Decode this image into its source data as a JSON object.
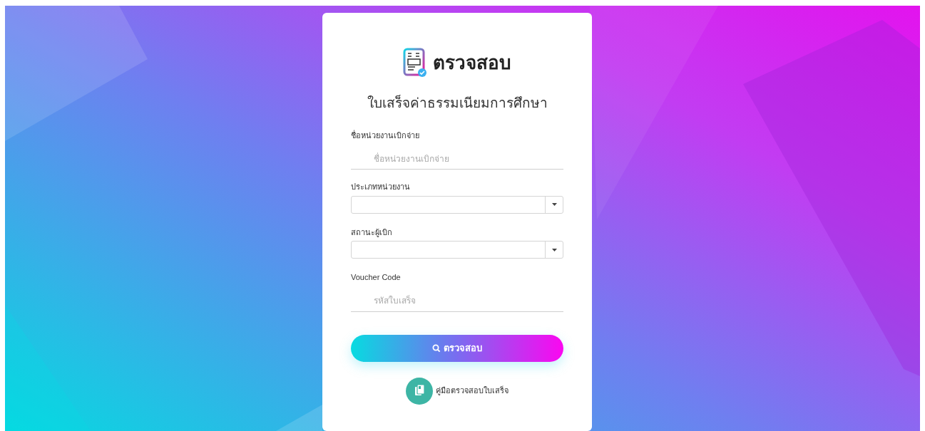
{
  "logo": {
    "title": "ตรวจสอบ"
  },
  "heading": "ใบเสร็จค่าธรรมเนียมการศึกษา",
  "fields": [
    {
      "kind": "text",
      "label": "ชื่อหน่วยงานเบิกจ่าย",
      "placeholder": "ชื่อหน่วยงานเบิกจ่าย"
    },
    {
      "kind": "select",
      "label": "ประเภทหน่วยงาน"
    },
    {
      "kind": "select",
      "label": "สถานะผู้เบิก"
    },
    {
      "kind": "text",
      "label": "Voucher Code",
      "placeholder": "รหัสใบเสร็จ"
    }
  ],
  "submit_button": "ตรวจสอบ",
  "manual_link": "คู่มือตรวจสอบใบเสร็จ"
}
